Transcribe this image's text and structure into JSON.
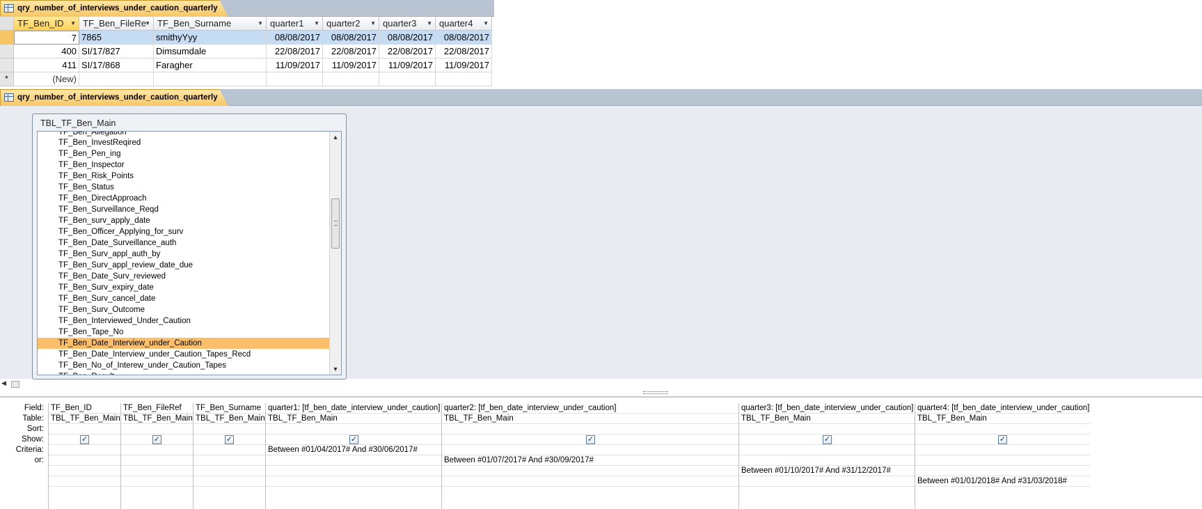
{
  "query_name": "qry_number_of_interviews_under_caution_quarterly",
  "datasheet": {
    "columns": [
      "TF_Ben_ID",
      "TF_Ben_FileRe",
      "TF_Ben_Surname",
      "quarter1",
      "quarter2",
      "quarter3",
      "quarter4"
    ],
    "rows": [
      {
        "cells": [
          "7",
          "7865",
          "smithyYyy",
          "08/08/2017",
          "08/08/2017",
          "08/08/2017",
          "08/08/2017"
        ]
      },
      {
        "cells": [
          "400",
          "SI/17/827",
          "Dimsumdale",
          "22/08/2017",
          "22/08/2017",
          "22/08/2017",
          "22/08/2017"
        ]
      },
      {
        "cells": [
          "411",
          "SI/17/868",
          "Faragher",
          "11/09/2017",
          "11/09/2017",
          "11/09/2017",
          "11/09/2017"
        ]
      }
    ],
    "new_row_label": "(New)",
    "new_row_marker": "*"
  },
  "design": {
    "table_name": "TBL_TF_Ben_Main",
    "partial_top_field": "TF_Ben_Allegation",
    "fields": [
      "TF_Ben_InvestReqired",
      "TF_Ben_Pen_ing",
      "TF_Ben_Inspector",
      "TF_Ben_Risk_Points",
      "TF_Ben_Status",
      "TF_Ben_DirectApproach",
      "TF_Ben_Surveillance_Reqd",
      "TF_Ben_surv_apply_date",
      "TF_Ben_Officer_Applying_for_surv",
      "TF_Ben_Date_Surveillance_auth",
      "TF_Ben_Surv_appl_auth_by",
      "TF_Ben_Surv_appl_review_date_due",
      "TF_Ben_Date_Surv_reviewed",
      "TF_Ben_Surv_expiry_date",
      "TF_Ben_Surv_cancel_date",
      "TF_Ben_Surv_Outcome",
      "TF_Ben_Interviewed_Under_Caution",
      "TF_Ben_Tape_No",
      "TF_Ben_Date_Interview_under_Caution",
      "TF_Ben_Date_Interview_under_Caution_Tapes_Recd",
      "TF_Ben_No_of_Interew_under_Caution_Tapes",
      "TF_Ben_Result"
    ],
    "selected_field": "TF_Ben_Date_Interview_under_Caution"
  },
  "qbe": {
    "row_labels": [
      "Field:",
      "Table:",
      "Sort:",
      "Show:",
      "Criteria:",
      "or:"
    ],
    "columns": [
      {
        "field": "TF_Ben_ID",
        "table": "TBL_TF_Ben_Main",
        "show": true,
        "criteria": [
          "",
          "",
          "",
          ""
        ]
      },
      {
        "field": "TF_Ben_FileRef",
        "table": "TBL_TF_Ben_Main",
        "show": true,
        "criteria": [
          "",
          "",
          "",
          ""
        ]
      },
      {
        "field": "TF_Ben_Surname",
        "table": "TBL_TF_Ben_Main",
        "show": true,
        "criteria": [
          "",
          "",
          "",
          ""
        ]
      },
      {
        "field": "quarter1: [tf_ben_date_interview_under_caution]",
        "table": "TBL_TF_Ben_Main",
        "show": true,
        "criteria": [
          "Between #01/04/2017# And #30/06/2017#",
          "",
          "",
          ""
        ]
      },
      {
        "field": "quarter2: [tf_ben_date_interview_under_caution]",
        "table": "TBL_TF_Ben_Main",
        "show": true,
        "criteria": [
          "",
          "Between #01/07/2017# And #30/09/2017#",
          "",
          ""
        ]
      },
      {
        "field": "quarter3: [tf_ben_date_interview_under_caution]",
        "table": "TBL_TF_Ben_Main",
        "show": true,
        "criteria": [
          "",
          "",
          "Between #01/10/2017# And #31/12/2017#",
          ""
        ]
      },
      {
        "field": "quarter4: [tf_ben_date_interview_under_caution]",
        "table": "TBL_TF_Ben_Main",
        "show": true,
        "criteria": [
          "",
          "",
          "",
          "Between #01/01/2018# And #31/03/2018#"
        ]
      }
    ],
    "checkmark": "✓"
  },
  "icons": {
    "query_tab": "datasheet-query-icon",
    "dropdown": "dropdown-arrow-icon",
    "scroll_up": "scroll-up-icon",
    "scroll_down": "scroll-down-icon",
    "scroll_left": "scroll-left-icon"
  },
  "colors": {
    "tab_accent": "#f7c664",
    "selected_row": "#c6dcf2",
    "selected_field": "#fbbf6b",
    "design_background": "#e8ecf1"
  }
}
